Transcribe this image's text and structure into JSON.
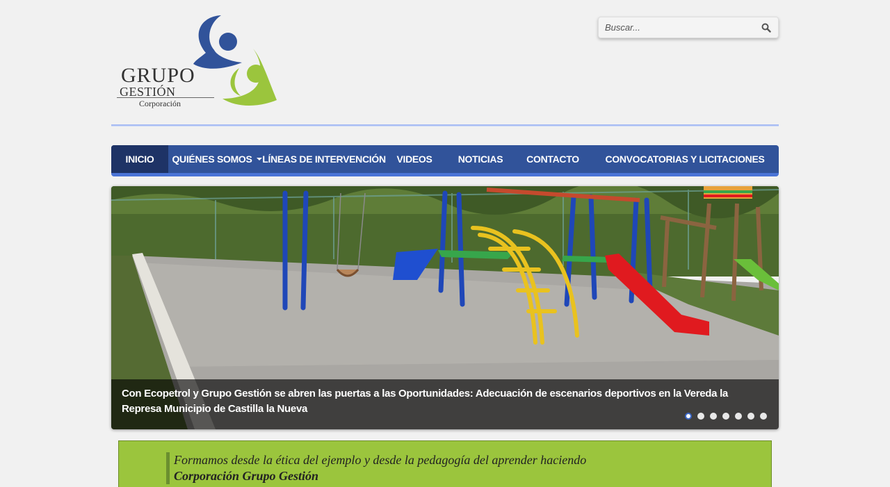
{
  "logo": {
    "grupo": "GRUPO",
    "gestion": "GESTIÓN",
    "corporacion": "Corporación",
    "colors": {
      "blue": "#31539a",
      "green": "#9bc53d"
    }
  },
  "search": {
    "placeholder": "Buscar...",
    "icon": "search-icon"
  },
  "nav": {
    "items": [
      {
        "label": "INICIO",
        "active": true
      },
      {
        "label": "QUIÉNES SOMOS",
        "dropdown": true
      },
      {
        "label": "LÍNEAS DE INTERVENCIÓN"
      },
      {
        "label": "VIDEOS"
      },
      {
        "label": "NOTICIAS"
      },
      {
        "label": "CONTACTO"
      },
      {
        "label": "CONVOCATORIAS Y LICITACIONES"
      }
    ]
  },
  "slider": {
    "caption": "Con Ecopetrol y Grupo Gestión se abren las puertas a las Oportunidades: Adecuación de escenarios deportivos en la Vereda la Represa Municipio de Castilla la Nueva",
    "slide_count": 7,
    "active_slide": 1
  },
  "banner": {
    "line1": "Formamos desde la ética del ejemplo y desde la pedagogía del aprender haciendo",
    "line2": "Corporación Grupo Gestión"
  },
  "colors": {
    "nav_bg": "#31539a",
    "nav_active": "#1e3366",
    "banner_bg": "#9bc53d",
    "page_bg": "#f1f1f1"
  }
}
